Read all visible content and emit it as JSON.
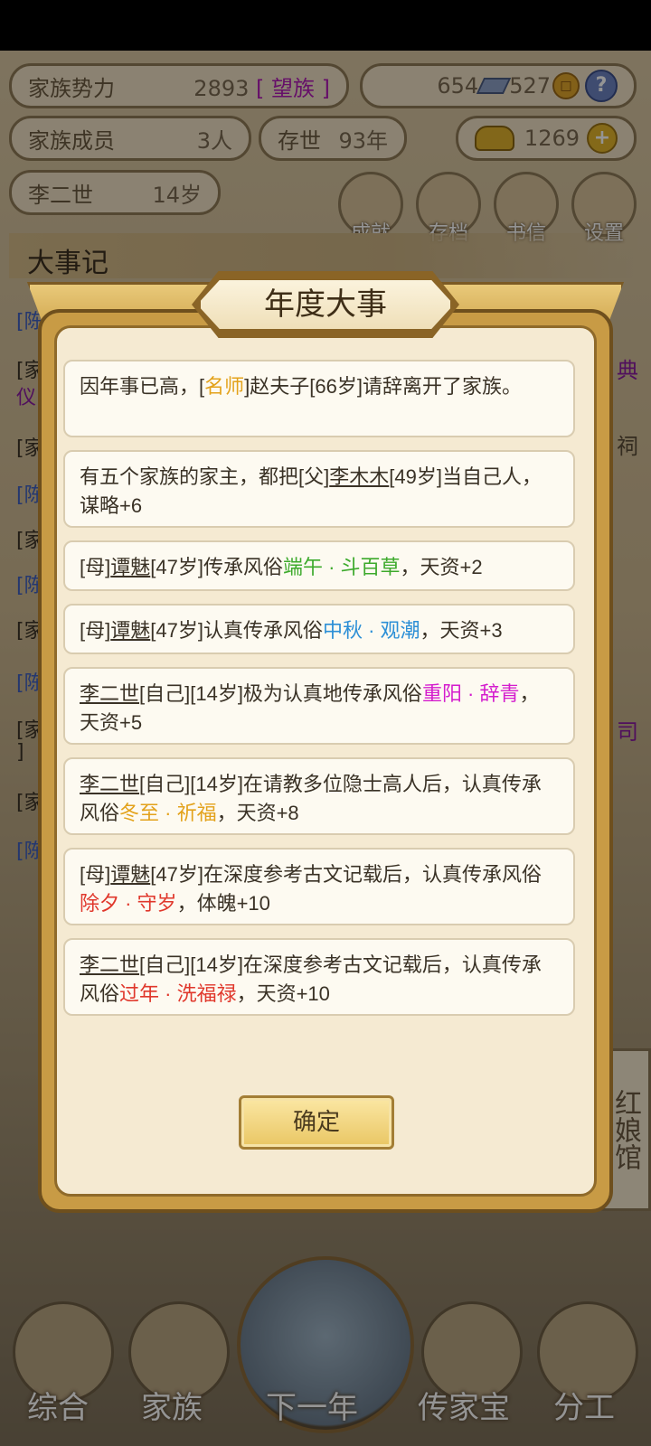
{
  "header": {
    "family_power_label": "家族势力",
    "family_power_value": "2893",
    "family_power_tag": "[ 望族 ]",
    "silver": "654",
    "coins": "527",
    "family_members_label": "家族成员",
    "family_members_value": "3人",
    "existence_label": "存世",
    "existence_value": "93年",
    "gold": "1269",
    "current_head_name": "李二世",
    "current_head_age": "14岁"
  },
  "menu": [
    {
      "label": "成就",
      "icon": "achievement-icon"
    },
    {
      "label": "存档",
      "icon": "save-icon"
    },
    {
      "label": "书信",
      "icon": "letter-icon"
    },
    {
      "label": "设置",
      "icon": "settings-icon"
    }
  ],
  "events_log_title": "大事记",
  "side_log_fragments": [
    "[陈",
    "[家",
    "仪",
    "[家",
    "[陈",
    "[家",
    "[陈",
    "[家",
    "[陈",
    "[家",
    "]",
    "[家",
    "[陈"
  ],
  "side_right_fragments": [
    "典",
    "祠",
    "司"
  ],
  "hongniang": "红娘馆",
  "bottom_nav": [
    "综合",
    "家族",
    "下一年",
    "传家宝",
    "分工"
  ],
  "modal": {
    "title": "年度大事",
    "confirm": "确定"
  },
  "events": [
    {
      "segments": [
        {
          "t": "因年事已高，["
        },
        {
          "t": "名师",
          "c": "orange"
        },
        {
          "t": "]赵夫子[66岁]请辞离开了家族。"
        }
      ]
    },
    {
      "segments": [
        {
          "t": "有五个家族的家主，都把[父]"
        },
        {
          "t": "李木木",
          "u": true
        },
        {
          "t": "[49岁]当自己人，谋略+6"
        }
      ]
    },
    {
      "segments": [
        {
          "t": "[母]"
        },
        {
          "t": "谭魅",
          "u": true
        },
        {
          "t": "[47岁]传承风俗"
        },
        {
          "t": "端午 · 斗百草",
          "c": "green"
        },
        {
          "t": "，天资+2"
        }
      ]
    },
    {
      "segments": [
        {
          "t": "[母]"
        },
        {
          "t": "谭魅",
          "u": true
        },
        {
          "t": "[47岁]认真传承风俗"
        },
        {
          "t": "中秋 · 观潮",
          "c": "blue"
        },
        {
          "t": "，天资+3"
        }
      ]
    },
    {
      "segments": [
        {
          "t": "李二世",
          "u": true
        },
        {
          "t": "[自己][14岁]极为认真地传承风俗"
        },
        {
          "t": "重阳 · 辞青",
          "c": "magenta"
        },
        {
          "t": "，天资+5"
        }
      ]
    },
    {
      "segments": [
        {
          "t": "李二世",
          "u": true
        },
        {
          "t": "[自己][14岁]在请教多位隐士高人后，认真传承风俗"
        },
        {
          "t": "冬至 · 祈福",
          "c": "orange"
        },
        {
          "t": "，天资+8"
        }
      ]
    },
    {
      "segments": [
        {
          "t": "[母]"
        },
        {
          "t": "谭魅",
          "u": true
        },
        {
          "t": "[47岁]在深度参考古文记载后，认真传承风俗"
        },
        {
          "t": "除夕 · 守岁",
          "c": "red"
        },
        {
          "t": "，体魄+10"
        }
      ]
    },
    {
      "segments": [
        {
          "t": "李二世",
          "u": true
        },
        {
          "t": "[自己][14岁]在深度参考古文记载后，认真传承风俗"
        },
        {
          "t": "过年 · 洗福禄",
          "c": "red"
        },
        {
          "t": "，天资+10"
        }
      ]
    }
  ],
  "colors": {
    "orange": "#e3a21b",
    "green": "#3daa2c",
    "blue": "#2c8fd6",
    "magenta": "#d41ccd",
    "red": "#e0372b"
  }
}
